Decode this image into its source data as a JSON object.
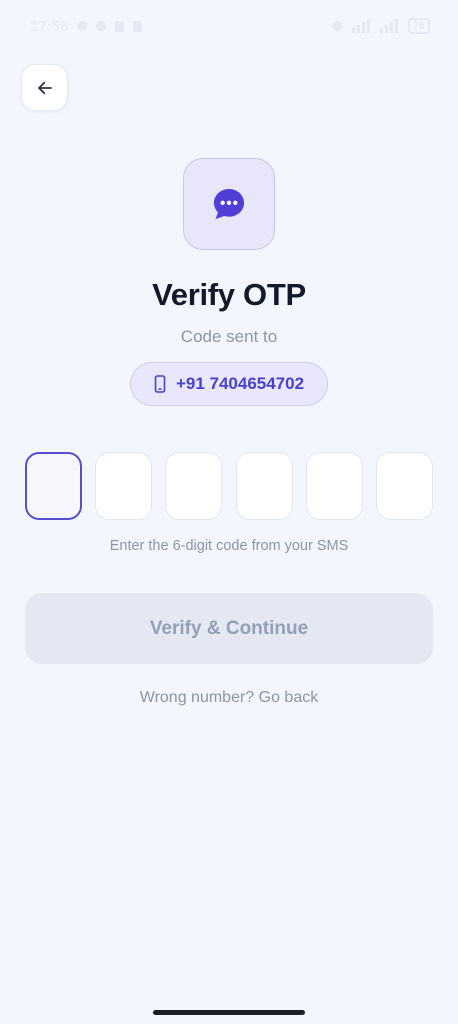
{
  "status_bar": {
    "time": "17:58",
    "battery": "76"
  },
  "header": {
    "back_icon": "arrow-left-icon"
  },
  "hero": {
    "icon": "chat-bubble-dots-icon",
    "title": "Verify OTP",
    "subtitle": "Code sent to",
    "phone_icon": "phone-icon",
    "phone_number": "+91 7404654702"
  },
  "otp": {
    "digits": [
      "",
      "",
      "",
      "",
      "",
      ""
    ],
    "active_index": 0,
    "hint": "Enter the 6-digit code from your SMS"
  },
  "actions": {
    "verify_label": "Verify & Continue",
    "wrong_number_label": "Wrong number? Go back"
  },
  "colors": {
    "background": "#f3f6fd",
    "accent": "#5b4bd1",
    "title": "#121a2c",
    "muted_text": "#8b95a7",
    "button_disabled_bg": "#e4e8f2",
    "button_disabled_text": "#93a0b6"
  }
}
